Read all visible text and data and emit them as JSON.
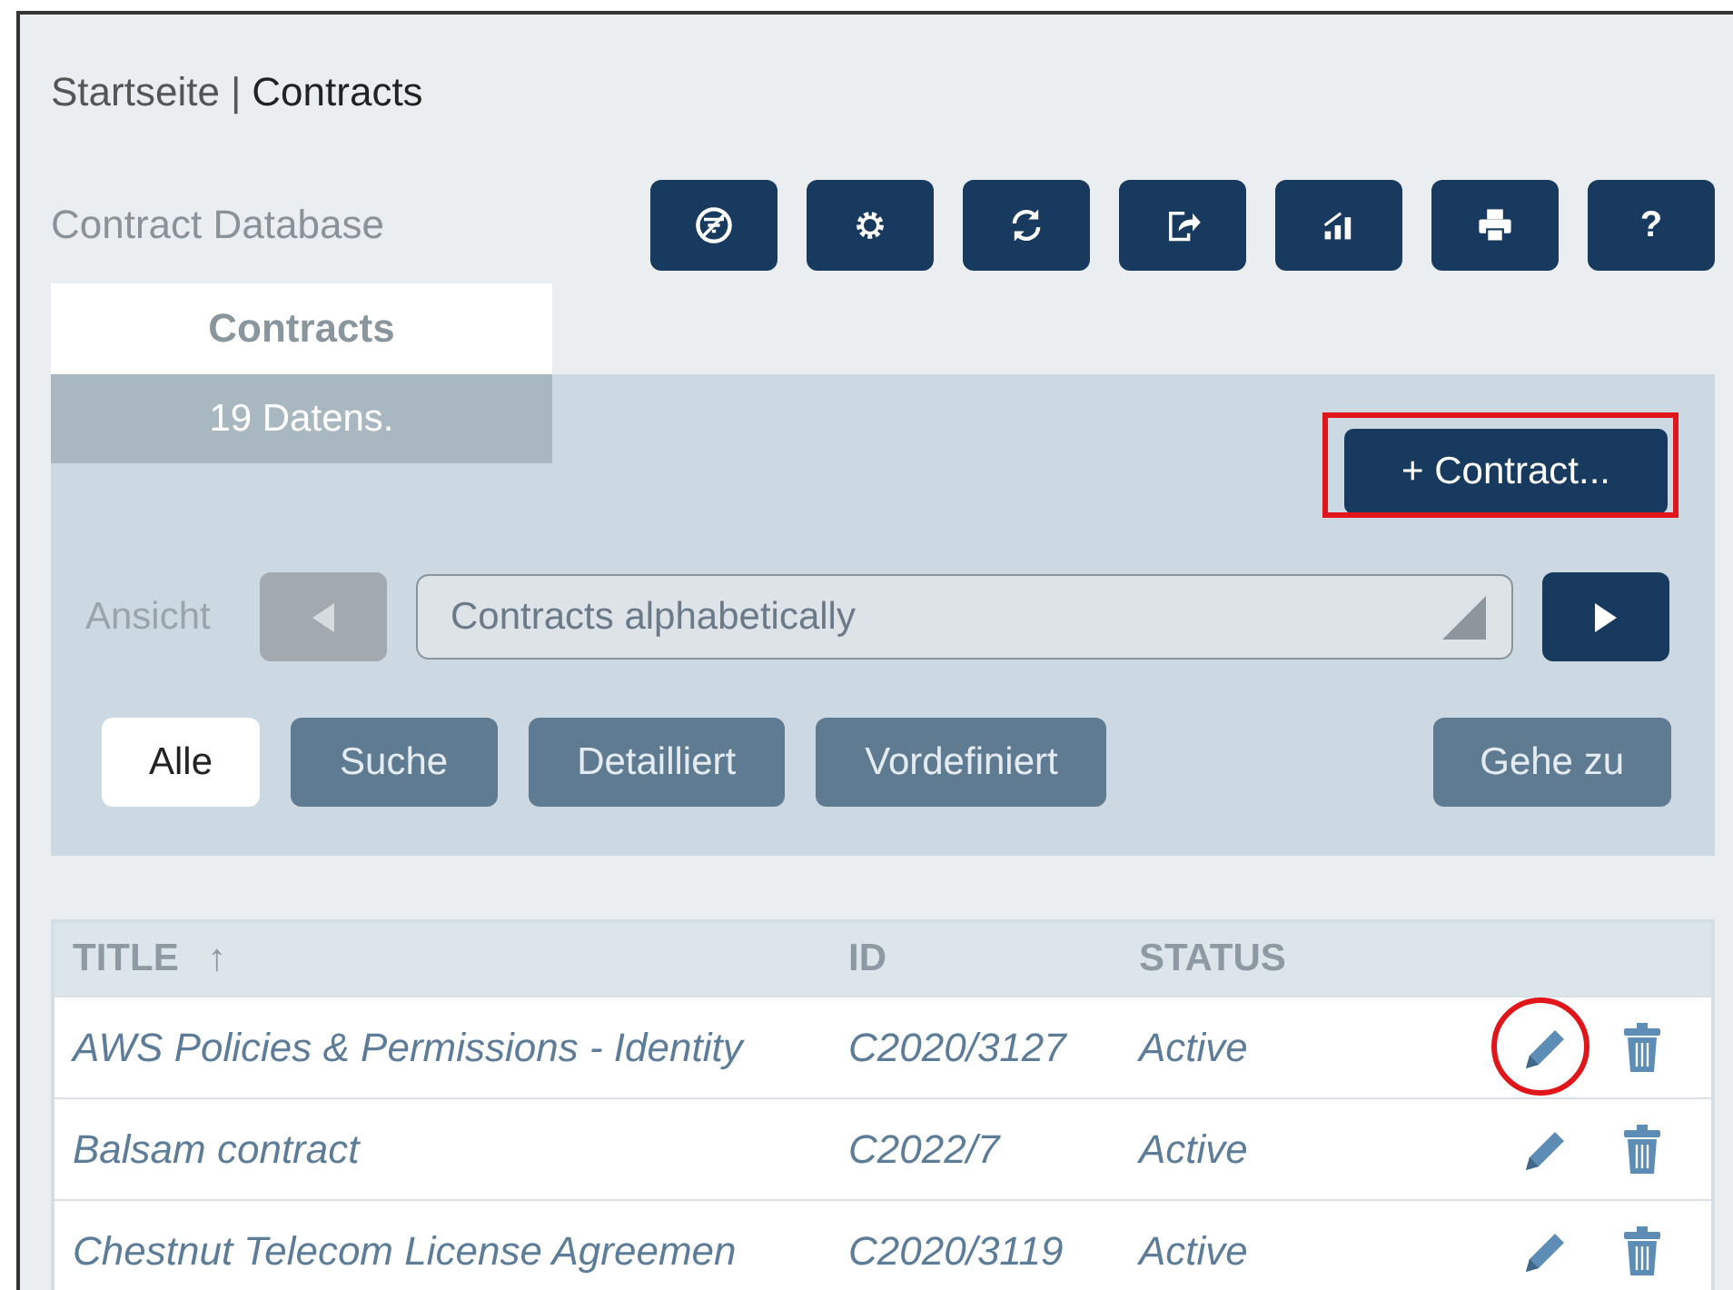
{
  "breadcrumb": {
    "home": "Startseite",
    "separator": "|",
    "current": "Contracts"
  },
  "app_title": "Contract Database",
  "toolbar": [
    {
      "kind": "nofilter"
    },
    {
      "kind": "gear"
    },
    {
      "kind": "refresh"
    },
    {
      "kind": "export"
    },
    {
      "kind": "chart"
    },
    {
      "kind": "print"
    },
    {
      "kind": "text",
      "label": "?"
    }
  ],
  "tab": {
    "label": "Contracts",
    "selected": true
  },
  "record_count": "19 Datens.",
  "new_button": {
    "label": "+ Contract...",
    "annotated": true
  },
  "view": {
    "label": "Ansicht",
    "prev_disabled": true,
    "value": "Contracts alphabetically",
    "next_disabled": false
  },
  "filters": [
    {
      "label": "Alle",
      "selected": true
    },
    {
      "label": "Suche",
      "selected": false
    },
    {
      "label": "Detailliert",
      "selected": false
    },
    {
      "label": "Vordefiniert",
      "selected": false
    }
  ],
  "goto_button": "Gehe zu",
  "table": {
    "columns": [
      {
        "label": "TITLE",
        "sort": "↑"
      },
      {
        "label": "ID"
      },
      {
        "label": "STATUS"
      }
    ],
    "rows": [
      {
        "title": "AWS Policies & Permissions - Identity",
        "id": "C2020/3127",
        "status": "Active",
        "edit_annotated": true
      },
      {
        "title": "Balsam contract",
        "id": "C2022/7",
        "status": "Active",
        "edit_annotated": false
      },
      {
        "title": "Chestnut Telecom License Agreemen",
        "id": "C2020/3119",
        "status": "Active",
        "edit_annotated": false
      }
    ]
  }
}
